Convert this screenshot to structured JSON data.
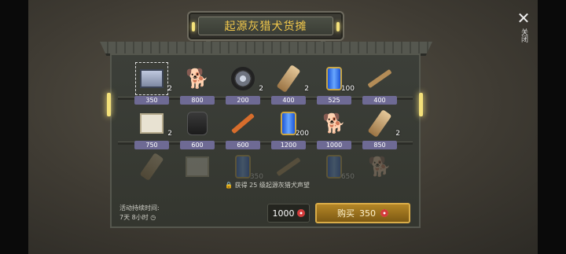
{
  "shop": {
    "title": "起源灰猎犬货摊",
    "notice": "获得 25 级起源灰猎犬声望",
    "duration_label": "活动持续时间:",
    "duration_value": "7天 8小时",
    "balance": "1000",
    "buy_label": "购买",
    "buy_price": "350",
    "close_label": "关闭",
    "currency_icon": "badge-icon"
  },
  "rows": [
    [
      {
        "name": "box",
        "qty": "2",
        "price": "350"
      },
      {
        "name": "dog",
        "qty": "",
        "price": "800"
      },
      {
        "name": "wheel",
        "qty": "2",
        "price": "200"
      },
      {
        "name": "roll",
        "qty": "2",
        "price": "400"
      },
      {
        "name": "can",
        "qty": "100",
        "price": "525"
      },
      {
        "name": "rifle",
        "qty": "",
        "price": "400"
      }
    ],
    [
      {
        "name": "crate",
        "qty": "2",
        "price": "750"
      },
      {
        "name": "bag",
        "qty": "",
        "price": "600"
      },
      {
        "name": "saw",
        "qty": "",
        "price": "600"
      },
      {
        "name": "can",
        "qty": "200",
        "price": "1200"
      },
      {
        "name": "dog",
        "qty": "",
        "price": "1000"
      },
      {
        "name": "roll",
        "qty": "2",
        "price": "850"
      }
    ]
  ],
  "locked_row": [
    {
      "qty": "350"
    },
    {
      "qty": "650"
    }
  ]
}
